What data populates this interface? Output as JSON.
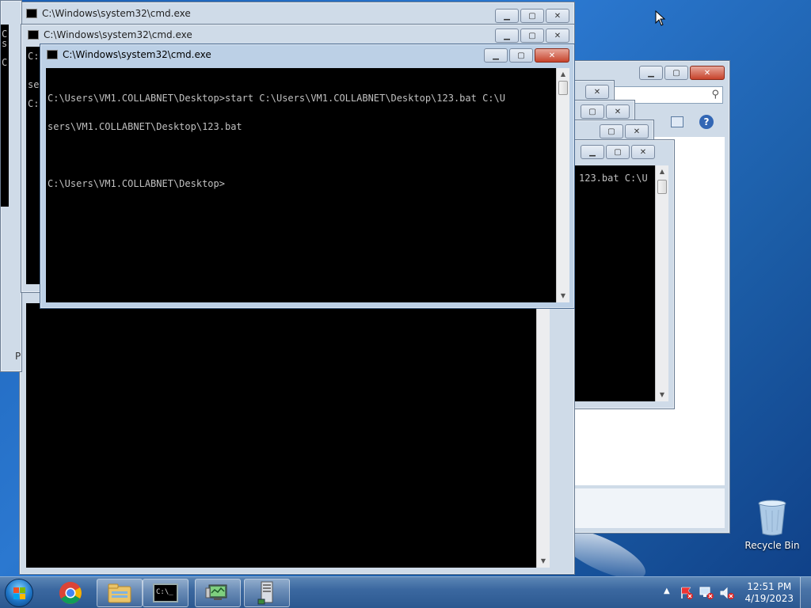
{
  "windows": {
    "cmd_title": "C:\\Windows\\system32\\cmd.exe",
    "active_console_lines": [
      "C:\\Users\\VM1.COLLABNET\\Desktop>start C:\\Users\\VM1.COLLABNET\\Desktop\\123.bat C:\\U",
      "sers\\VM1.COLLABNET\\Desktop\\123.bat",
      "",
      "C:\\Users\\VM1.COLLABNET\\Desktop>"
    ],
    "right_console_fragment": "123.bat C:\\U",
    "left_fragments": [
      "C",
      "s",
      "C"
    ],
    "left_fragment_2": "se",
    "left_fragment_3": "C:",
    "left_fragment_p": "P"
  },
  "controls": {
    "minimize_glyph": "▁",
    "maximize_glyph": "▢",
    "close_glyph": "✕",
    "scroll_up_glyph": "▲",
    "scroll_down_glyph": "▼",
    "search_glyph": "⚲",
    "help_glyph": "?"
  },
  "desktop": {
    "recycle_bin_label": "Recycle Bin"
  },
  "taskbar": {
    "time": "12:51 PM",
    "date": "4/19/2023",
    "tray_expand_glyph": "▲",
    "cmd_icon_text": "C:\\_",
    "icons": [
      "start-orb",
      "chrome-icon",
      "file-explorer-icon",
      "cmd-icon",
      "network-monitor-icon",
      "server-icon"
    ]
  },
  "colors": {
    "console_bg": "#000000",
    "console_fg": "#c0c0c0",
    "desktop_blue": "#1a5fb4"
  }
}
